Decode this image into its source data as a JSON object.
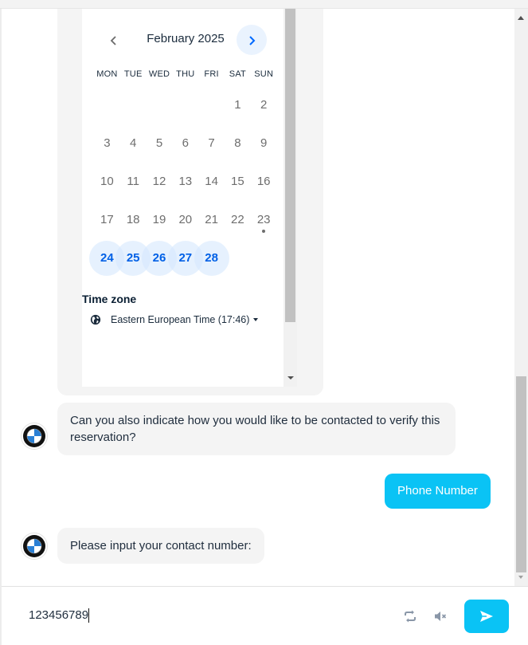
{
  "calendar": {
    "month_title": "February 2025",
    "prev_icon": "chevron-left-icon",
    "next_icon": "chevron-right-icon",
    "weekdays": [
      "MON",
      "TUE",
      "WED",
      "THU",
      "FRI",
      "SAT",
      "SUN"
    ],
    "weeks": [
      [
        null,
        null,
        null,
        null,
        null,
        "1",
        "2"
      ],
      [
        "3",
        "4",
        "5",
        "6",
        "7",
        "8",
        "9"
      ],
      [
        "10",
        "11",
        "12",
        "13",
        "14",
        "15",
        "16"
      ],
      [
        "17",
        "18",
        "19",
        "20",
        "21",
        "22",
        "23"
      ],
      [
        "24",
        "25",
        "26",
        "27",
        "28",
        null,
        null
      ]
    ],
    "available_days": [
      "24",
      "25",
      "26",
      "27",
      "28"
    ],
    "today": "23",
    "timezone_label": "Time zone",
    "timezone_value": "Eastern European Time (17:46)",
    "timezone_icon": "globe-icon",
    "accent_color": "#0060e6"
  },
  "messages": [
    {
      "from": "bot",
      "text": "Can you also indicate how you would like to be contacted to verify this reservation?"
    },
    {
      "from": "user",
      "text": "Phone Number"
    },
    {
      "from": "bot",
      "text": "Please input your contact number:"
    }
  ],
  "bot_avatar": "bmw-logo",
  "composer": {
    "value": "123456789",
    "refresh_icon": "refresh-icon",
    "mute_icon": "mute-icon",
    "send_icon": "send-icon",
    "accent_color": "#0ac3f5"
  }
}
